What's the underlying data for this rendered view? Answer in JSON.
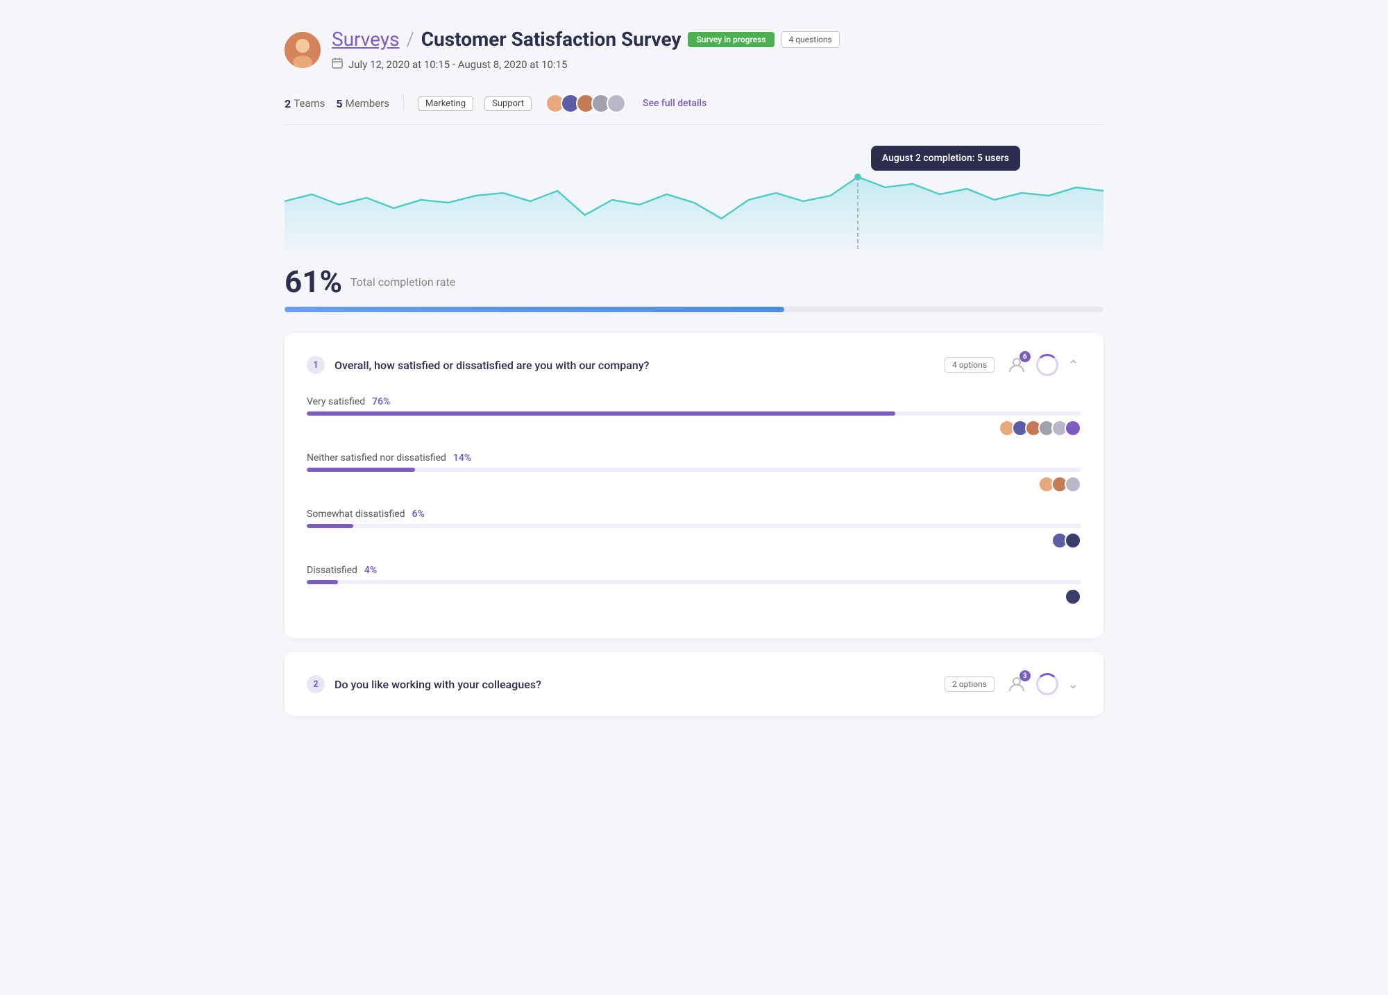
{
  "header": {
    "surveys_label": "Surveys",
    "separator": "/",
    "title": "Customer Satisfaction Survey",
    "badge_progress": "Survey in progress",
    "badge_questions": "4 questions",
    "date_range": "July 12, 2020 at 10:15  -  August 8, 2020 at 10:15"
  },
  "stats": {
    "teams_count": "2",
    "teams_label": "Teams",
    "members_count": "5",
    "members_label": "Members",
    "tags": [
      "Marketing",
      "Support"
    ],
    "see_details_label": "See full details"
  },
  "chart": {
    "tooltip": "August 2 completion: 5 users"
  },
  "completion": {
    "percent": "61%",
    "label": "Total completion rate",
    "fill_width": "61"
  },
  "questions": [
    {
      "number": "1",
      "text": "Overall, how satisfied or dissatisfied are you with our company?",
      "options_label": "4 options",
      "respondent_count": "6",
      "answers": [
        {
          "label": "Very satisfied",
          "percent": 76,
          "percent_label": "76%",
          "avatar_count": 6
        },
        {
          "label": "Neither satisfied nor dissatisfied",
          "percent": 14,
          "percent_label": "14%",
          "avatar_count": 3
        },
        {
          "label": "Somewhat dissatisfied",
          "percent": 6,
          "percent_label": "6%",
          "avatar_count": 2
        },
        {
          "label": "Dissatisfied",
          "percent": 4,
          "percent_label": "4%",
          "avatar_count": 1
        }
      ]
    },
    {
      "number": "2",
      "text": "Do you like working with your colleagues?",
      "options_label": "2 options",
      "respondent_count": "3"
    }
  ]
}
